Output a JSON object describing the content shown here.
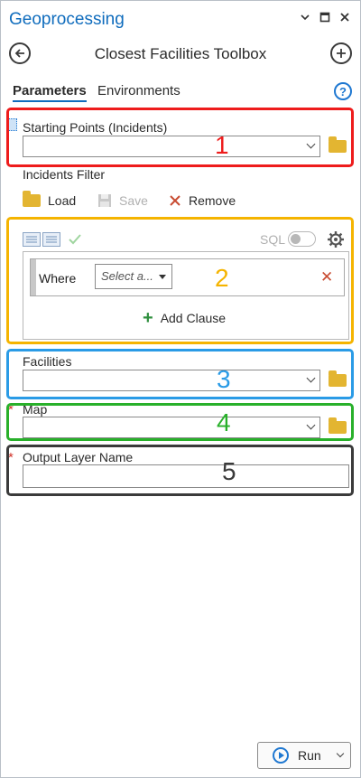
{
  "window": {
    "title": "Geoprocessing",
    "controls": {
      "dropdown_icon": "chevron-down",
      "restore_icon": "restore-square",
      "close_icon": "close-x"
    }
  },
  "header": {
    "tool_title": "Closest Facilities Toolbox",
    "back_icon": "back-arrow",
    "add_icon": "plus-circle"
  },
  "tabs": [
    {
      "label": "Parameters",
      "active": true
    },
    {
      "label": "Environments",
      "active": false
    }
  ],
  "help_glyph": "?",
  "params": {
    "starting_points": {
      "label": "Starting Points (Incidents)",
      "value": ""
    },
    "incidents_filter": {
      "label": "Incidents Filter",
      "load": "Load",
      "save": "Save",
      "remove": "Remove",
      "sql_label": "SQL",
      "sql_enabled": false,
      "clause": {
        "where_label": "Where",
        "field_placeholder": "Select a...",
        "remove_glyph": "✕"
      },
      "add_clause": "Add Clause",
      "add_glyph": "+"
    },
    "facilities": {
      "label": "Facilities",
      "value": ""
    },
    "map": {
      "label": "Map",
      "required": true,
      "value": ""
    },
    "output_layer": {
      "label": "Output Layer Name",
      "required": true,
      "value": ""
    }
  },
  "required_marker": "*",
  "annotations": [
    {
      "number": "1",
      "color": "#ee1c1c"
    },
    {
      "number": "2",
      "color": "#f5b400"
    },
    {
      "number": "3",
      "color": "#2a9be6"
    },
    {
      "number": "4",
      "color": "#28b02a"
    },
    {
      "number": "5",
      "color": "#3a3a3a"
    }
  ],
  "footer": {
    "run_label": "Run"
  }
}
